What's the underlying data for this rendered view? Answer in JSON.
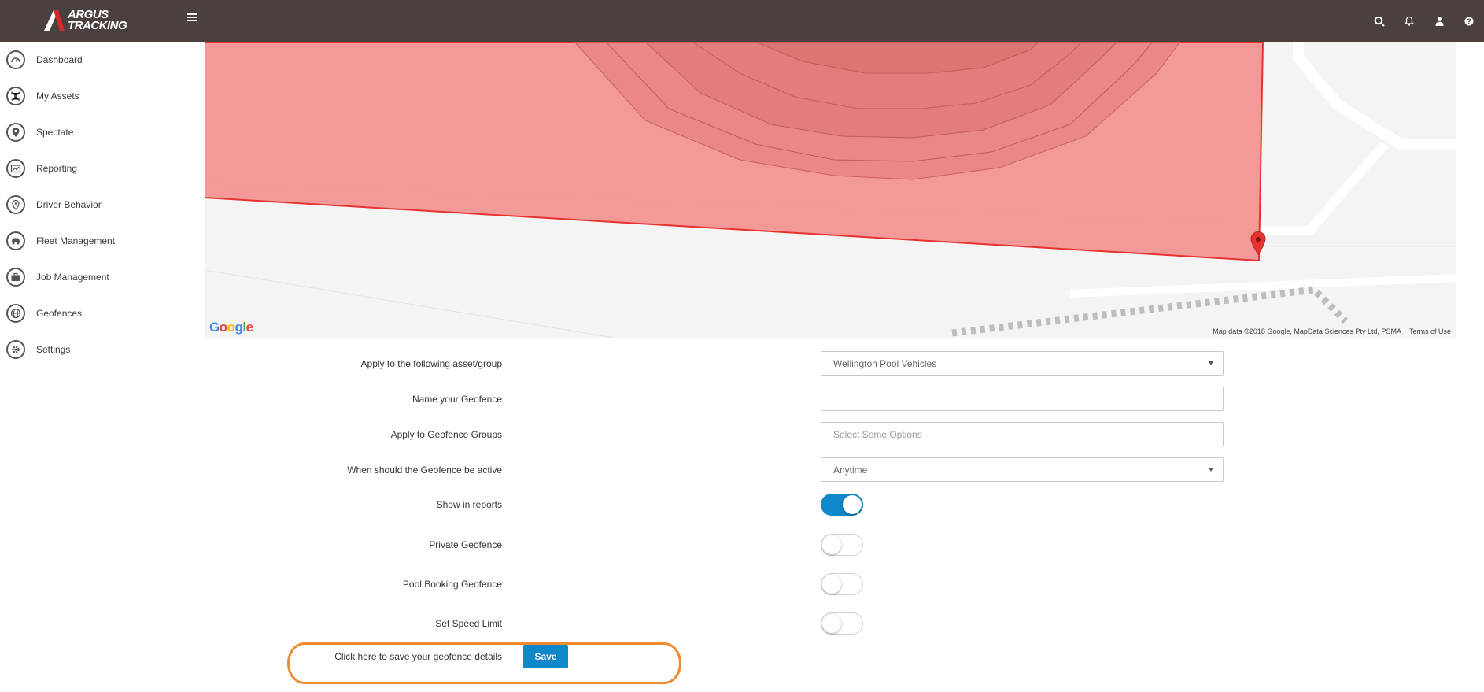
{
  "app": {
    "logo_line1": "ARGUS",
    "logo_line2": "TRACKING",
    "colors": {
      "topbar": "#4a403d",
      "accent": "#0e88c8",
      "geofence_fill": "#f47c7c",
      "geofence_stroke": "#e8322f",
      "highlight": "#f08a30"
    }
  },
  "topbar": {
    "icons": [
      "search-icon",
      "bell-icon",
      "user-icon",
      "help-icon"
    ]
  },
  "sidebar": {
    "items": [
      {
        "label": "Dashboard",
        "icon": "gauge-icon"
      },
      {
        "label": "My Assets",
        "icon": "assets-icon"
      },
      {
        "label": "Spectate",
        "icon": "location-pin-icon"
      },
      {
        "label": "Reporting",
        "icon": "report-icon"
      },
      {
        "label": "Driver Behavior",
        "icon": "driver-icon"
      },
      {
        "label": "Fleet Management",
        "icon": "car-icon"
      },
      {
        "label": "Job Management",
        "icon": "briefcase-icon"
      },
      {
        "label": "Geofences",
        "icon": "globe-icon"
      },
      {
        "label": "Settings",
        "icon": "gear-icon"
      }
    ]
  },
  "map": {
    "google": "Google",
    "attribution": "Map data ©2018 Google, MapData Sciences Pty Ltd, PSMA",
    "terms": "Terms of Use"
  },
  "form": {
    "asset_group": {
      "label": "Apply to the following asset/group",
      "value": "Wellington Pool Vehicles"
    },
    "name": {
      "label": "Name your Geofence",
      "value": "",
      "placeholder": ""
    },
    "groups": {
      "label": "Apply to Geofence Groups",
      "placeholder": "Select Some Options"
    },
    "active": {
      "label": "When should the Geofence be active",
      "value": "Anytime"
    },
    "show_in_reports": {
      "label": "Show in reports",
      "on": true
    },
    "private": {
      "label": "Private Geofence",
      "on": false
    },
    "pool_booking": {
      "label": "Pool Booking Geofence",
      "on": false
    },
    "speed_limit": {
      "label": "Set Speed Limit",
      "on": false
    },
    "save": {
      "label": "Click here to save your geofence details",
      "button": "Save"
    }
  }
}
